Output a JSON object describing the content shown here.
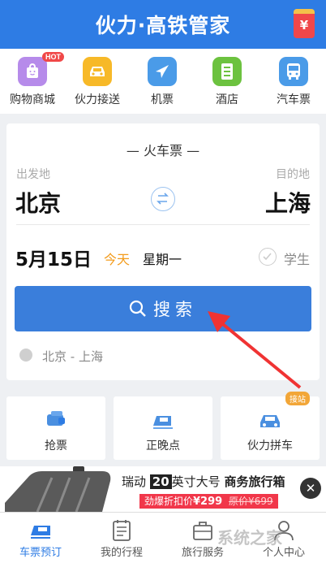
{
  "header": {
    "title": "伙力·高铁管家",
    "redpack_icon": "red-packet-icon",
    "redpack_glyph": "¥"
  },
  "categories": [
    {
      "label": "购物商城",
      "icon": "shopping-bag-icon",
      "color": "#b68bea",
      "badge": "HOT"
    },
    {
      "label": "伙力接送",
      "icon": "car-icon",
      "color": "#f7b928"
    },
    {
      "label": "机票",
      "icon": "airplane-icon",
      "color": "#4a9be8"
    },
    {
      "label": "酒店",
      "icon": "hotel-icon",
      "color": "#6cc23f"
    },
    {
      "label": "汽车票",
      "icon": "bus-icon",
      "color": "#4a9be8"
    }
  ],
  "ticket": {
    "title": "— 火车票 —",
    "from_label": "出发地",
    "to_label": "目的地",
    "from": "北京",
    "to": "上海",
    "date": "5月15日",
    "today": "今天",
    "weekday": "星期一",
    "student": "学生",
    "search": "搜索",
    "history": "北京 - 上海"
  },
  "services": [
    {
      "label": "抢票",
      "icon": "grab-ticket-icon"
    },
    {
      "label": "正晚点",
      "icon": "train-delay-icon"
    },
    {
      "label": "伙力拼车",
      "icon": "carpool-icon",
      "badge": "接站"
    }
  ],
  "ad": {
    "brand": "瑞动",
    "size": "20",
    "text1": "英寸大号",
    "text2": "商务旅行箱",
    "promo": "劲爆折扣价",
    "price": "¥299",
    "orig_label": "原价",
    "orig_price": "¥699",
    "close": "✕"
  },
  "nav": [
    {
      "label": "车票预订",
      "icon": "train-ticket-icon",
      "active": true
    },
    {
      "label": "我的行程",
      "icon": "itinerary-icon",
      "active": false
    },
    {
      "label": "旅行服务",
      "icon": "travel-service-icon",
      "active": false
    },
    {
      "label": "个人中心",
      "icon": "profile-icon",
      "active": false
    }
  ],
  "watermark": "系统之家",
  "colors": {
    "brand": "#2e7ce4",
    "today": "#f39b1a",
    "ad_red": "#f1374a"
  }
}
